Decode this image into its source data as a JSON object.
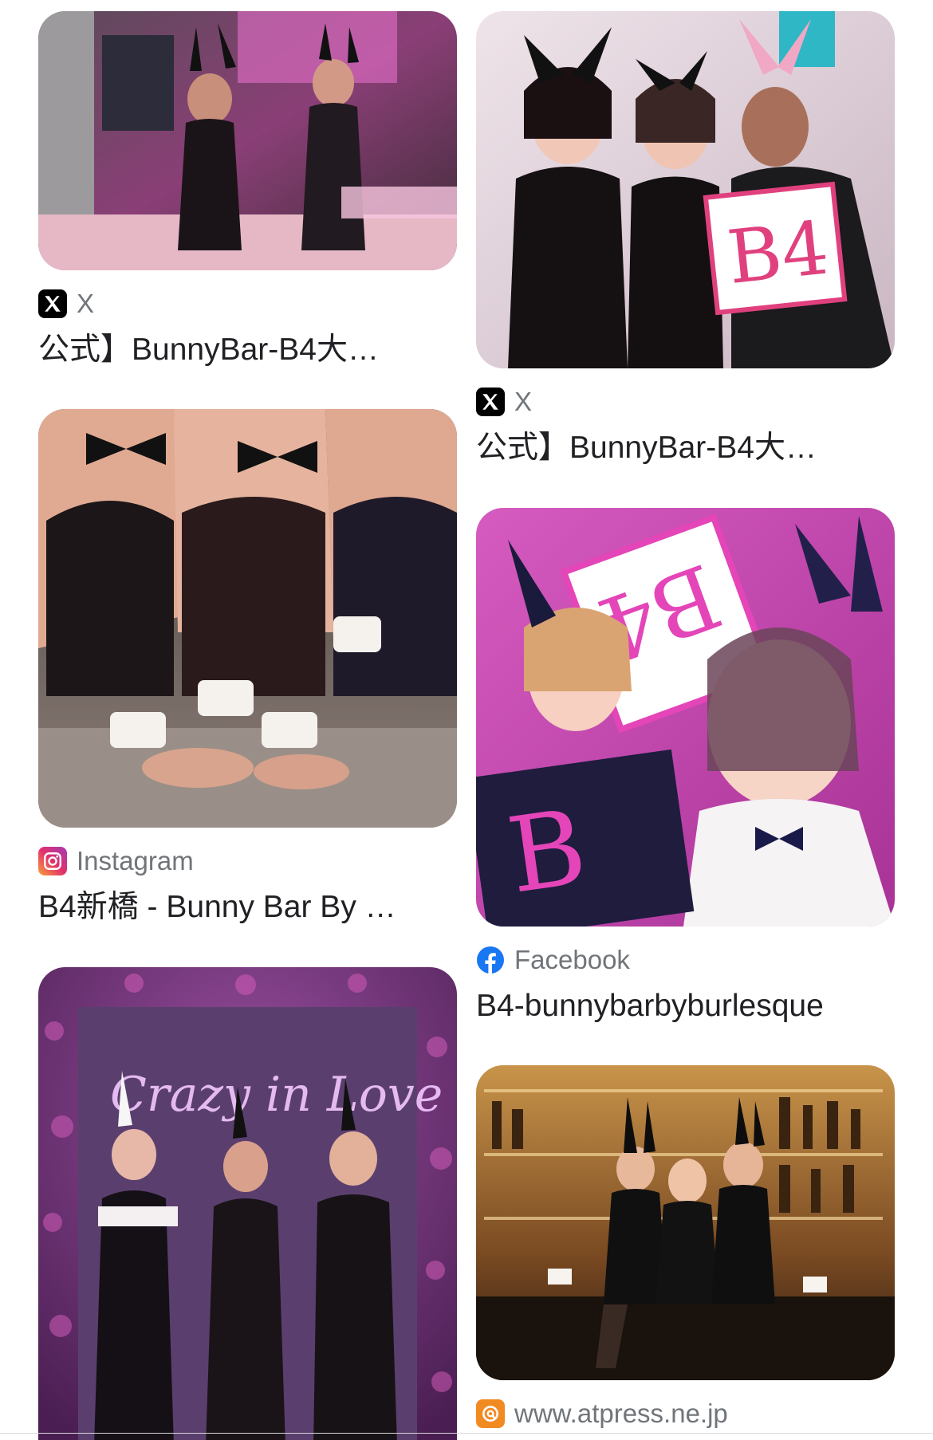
{
  "results": {
    "left": [
      {
        "source": {
          "name": "X",
          "icon": "x-logo-icon"
        },
        "title": "公式】BunnyBar-B4大…"
      },
      {
        "source": {
          "name": "Instagram",
          "icon": "instagram-icon"
        },
        "title": "B4新橋 - Bunny Bar By …"
      },
      {
        "source": {
          "name": "",
          "icon": ""
        },
        "title": ""
      }
    ],
    "right": [
      {
        "source": {
          "name": "X",
          "icon": "x-logo-icon"
        },
        "title": "公式】BunnyBar-B4大…"
      },
      {
        "source": {
          "name": "Facebook",
          "icon": "facebook-icon"
        },
        "title": "B4-bunnybarbyburlesque"
      },
      {
        "source": {
          "name": "www.atpress.ne.jp",
          "icon": "atpress-icon"
        },
        "title": ""
      }
    ]
  },
  "colors": {
    "source_text": "#70757a",
    "title_text": "#202124",
    "facebook_blue": "#1877f2",
    "atpress_orange": "#f28a22",
    "x_black": "#000000"
  }
}
